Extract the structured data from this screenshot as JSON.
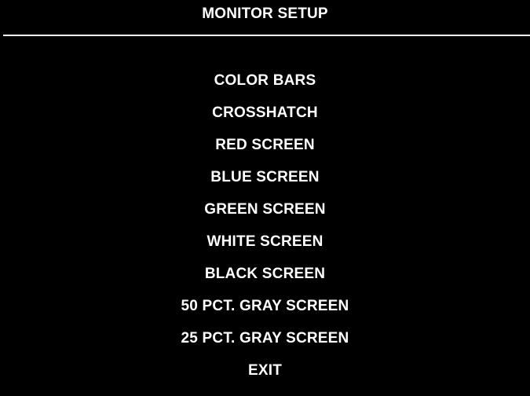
{
  "screen": {
    "title": "MONITOR SETUP",
    "background_color": "#000000",
    "text_color": "#ffffff"
  },
  "menu": {
    "items": [
      {
        "label": "COLOR BARS"
      },
      {
        "label": "CROSSHATCH"
      },
      {
        "label": "RED SCREEN"
      },
      {
        "label": "BLUE SCREEN"
      },
      {
        "label": "GREEN SCREEN"
      },
      {
        "label": "WHITE SCREEN"
      },
      {
        "label": "BLACK SCREEN"
      },
      {
        "label": "50 PCT. GRAY SCREEN"
      },
      {
        "label": "25 PCT. GRAY SCREEN"
      },
      {
        "label": "EXIT"
      }
    ]
  }
}
